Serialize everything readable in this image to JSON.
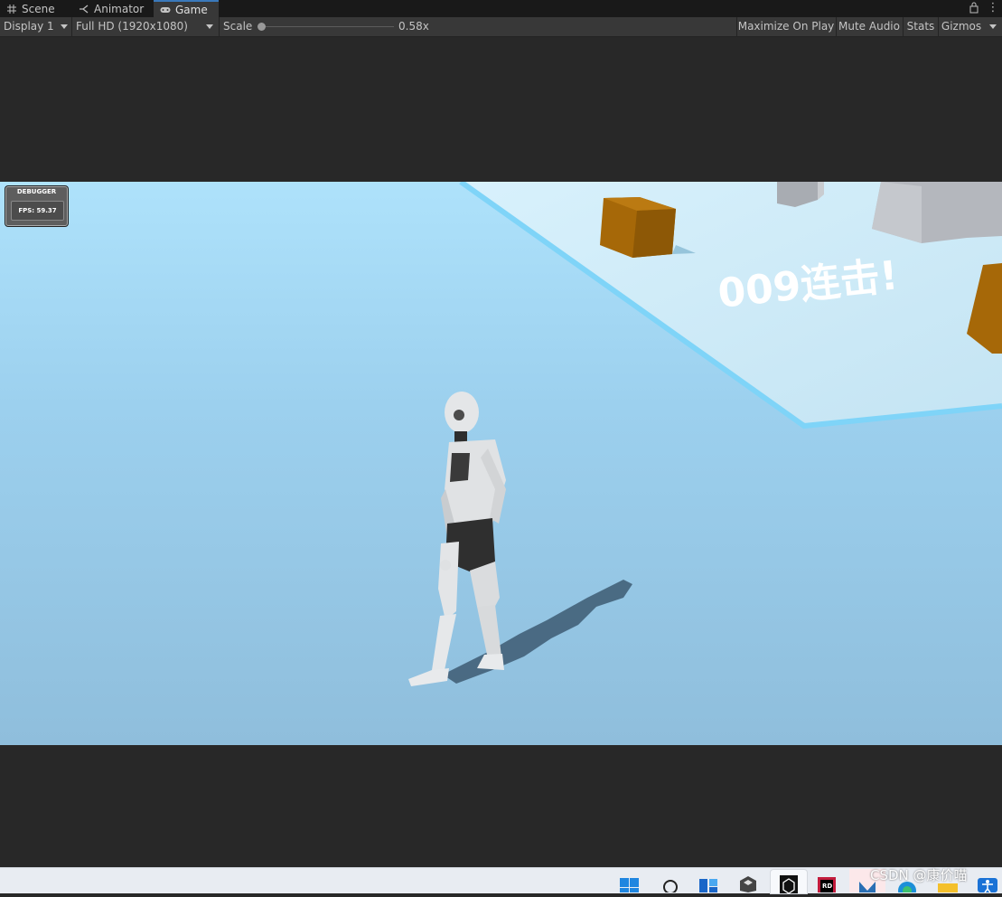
{
  "tabs": [
    {
      "label": "Scene",
      "icon": "grid-icon",
      "active": false
    },
    {
      "label": "Animator",
      "icon": "animator-icon",
      "active": false
    },
    {
      "label": "Game",
      "icon": "gamepad-icon",
      "active": true
    }
  ],
  "toolbar": {
    "display": "Display 1",
    "resolution": "Full HD (1920x1080)",
    "scale_label": "Scale",
    "scale_value": "0.58x",
    "maximize": "Maximize On Play",
    "mute": "Mute Audio",
    "stats": "Stats",
    "gizmos": "Gizmos"
  },
  "game": {
    "debugger_title": "DEBUGGER",
    "fps": "FPS: 59.37",
    "combo_text": "009连击!"
  },
  "taskbar": {
    "icons": [
      "windows-start-icon",
      "search-icon",
      "task-view-icon",
      "unity-hub-icon",
      "unity-icon",
      "rider-icon",
      "store-icon",
      "visual-studio-icon",
      "edge-icon",
      "file-explorer-icon",
      "accessibility-icon"
    ],
    "watermark": "CSDN @康价喵"
  },
  "colors": {
    "accent": "#3a79bb",
    "crate": "#a8690a",
    "ground": "#9cd0ee"
  }
}
